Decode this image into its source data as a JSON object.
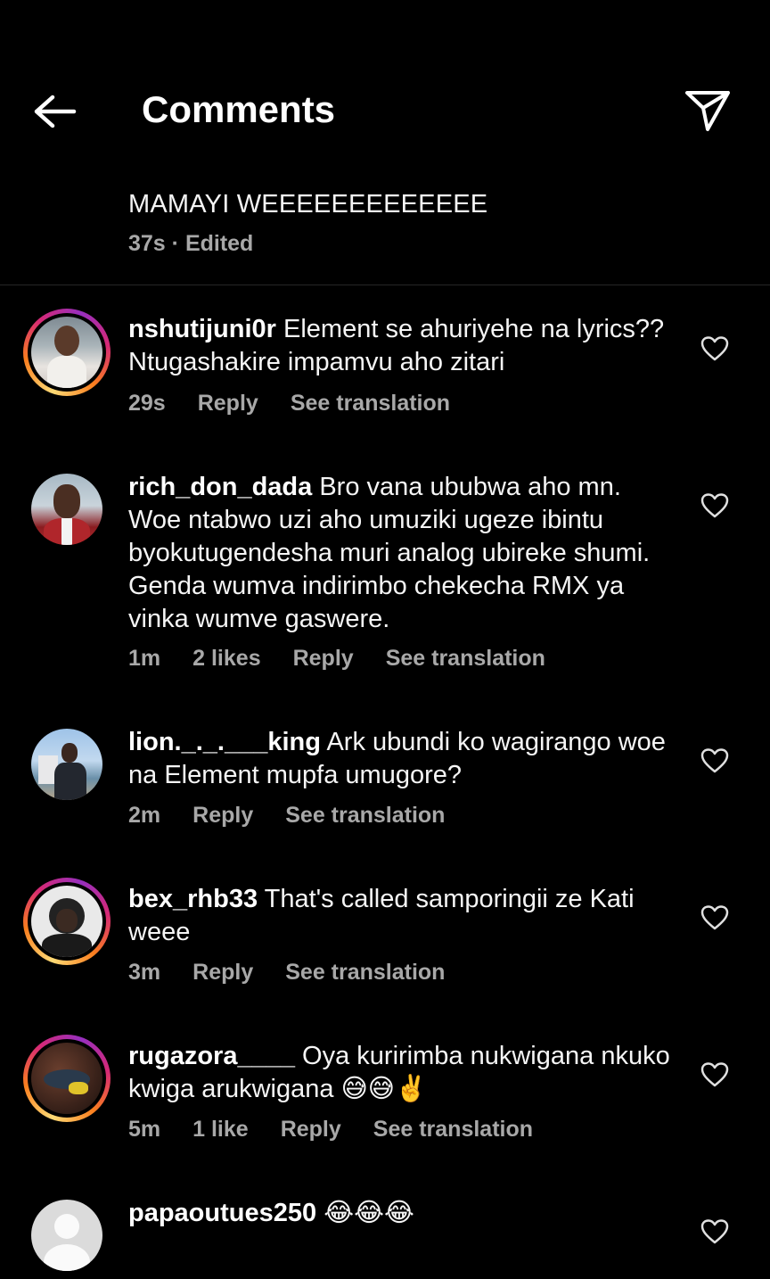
{
  "header": {
    "title": "Comments"
  },
  "caption": {
    "text": "MAMAYI WEEEEEEEEEEEEE",
    "time": "37s",
    "edited": "Edited"
  },
  "comments": [
    {
      "username": "nshutijuni0r",
      "text": " Element se ahuriyehe na lyrics?? Ntugashakire impamvu aho zitari",
      "time": "29s",
      "likes": "",
      "reply": "Reply",
      "translate": "See translation"
    },
    {
      "username": "rich_don_dada",
      "text": " Bro vana ububwa aho mn. Woe ntabwo uzi aho umuziki ugeze ibintu byokutugendesha muri analog ubireke shumi. Genda wumva indirimbo chekecha RMX ya vinka wumve gaswere.",
      "time": "1m",
      "likes": "2 likes",
      "reply": "Reply",
      "translate": "See translation"
    },
    {
      "username": "lion._._.___king",
      "text": " Ark ubundi ko wagirango woe na Element mupfa umugore?",
      "time": "2m",
      "likes": "",
      "reply": "Reply",
      "translate": "See translation"
    },
    {
      "username": "bex_rhb33",
      "text": " That's called samporingii ze Kati weee",
      "time": "3m",
      "likes": "",
      "reply": "Reply",
      "translate": "See translation"
    },
    {
      "username": "rugazora____",
      "text": " Oya kuririmba nukwigana nkuko kwiga arukwigana 😅😅✌️",
      "time": "5m",
      "likes": "1 like",
      "reply": "Reply",
      "translate": "See translation"
    },
    {
      "username": "papaoutues250",
      "text": " 😂😂😂",
      "time": "",
      "likes": "",
      "reply": "",
      "translate": ""
    }
  ]
}
